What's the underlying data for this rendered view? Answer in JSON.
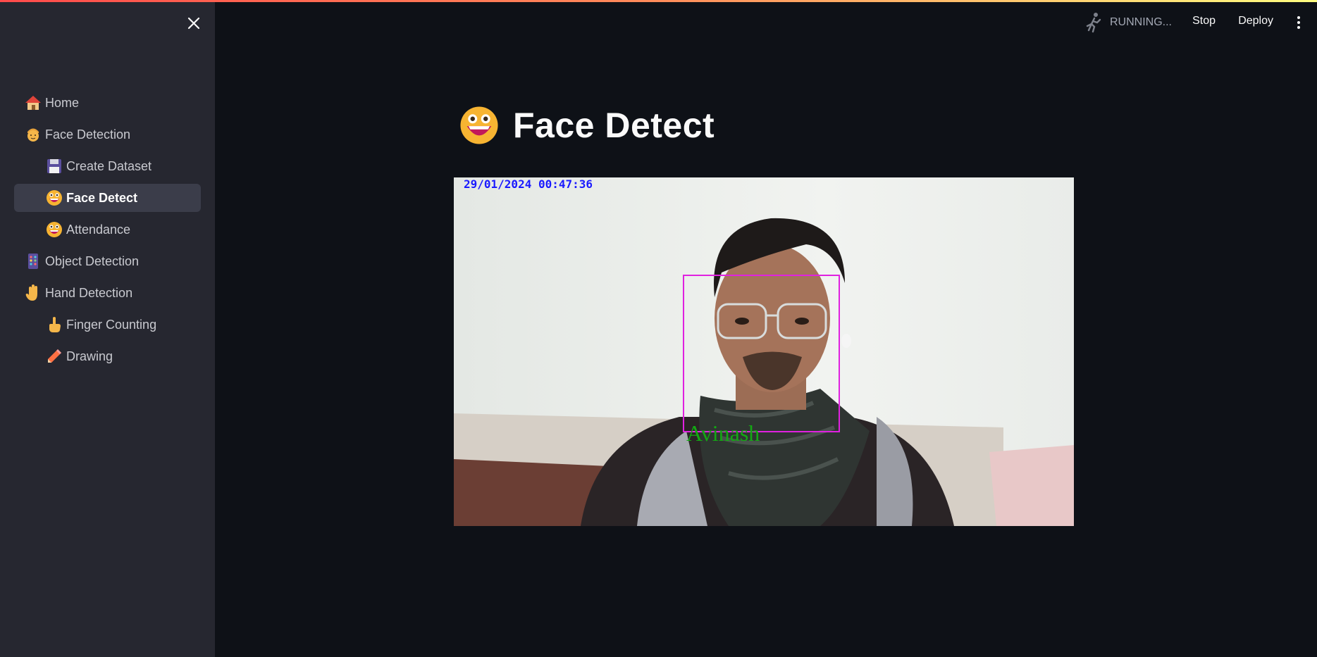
{
  "sidebar": {
    "items": [
      {
        "label": "Home",
        "icon": "house-icon"
      },
      {
        "label": "Face Detection",
        "icon": "face-icon"
      },
      {
        "label": "Create Dataset",
        "icon": "floppy-disk-icon"
      },
      {
        "label": "Face Detect",
        "icon": "grinning-face-icon"
      },
      {
        "label": "Attendance",
        "icon": "grinning-face-icon"
      },
      {
        "label": "Object Detection",
        "icon": "abacus-icon"
      },
      {
        "label": "Hand Detection",
        "icon": "raised-hand-icon"
      },
      {
        "label": "Finger Counting",
        "icon": "pointing-finger-icon"
      },
      {
        "label": "Drawing",
        "icon": "pencil-icon"
      }
    ],
    "active_index": 3
  },
  "header": {
    "status": "RUNNING...",
    "stop_label": "Stop",
    "deploy_label": "Deploy"
  },
  "main": {
    "title": "Face Detect",
    "feed": {
      "timestamp": "29/01/2024 00:47:36",
      "detected_name": "Avinash"
    }
  },
  "colors": {
    "accent": "#ff4b4b",
    "sidebar_bg": "#262730",
    "page_bg": "#0e1117",
    "box": "#e021e0",
    "name_text": "#13a813",
    "timestamp_text": "#1a1aff"
  }
}
